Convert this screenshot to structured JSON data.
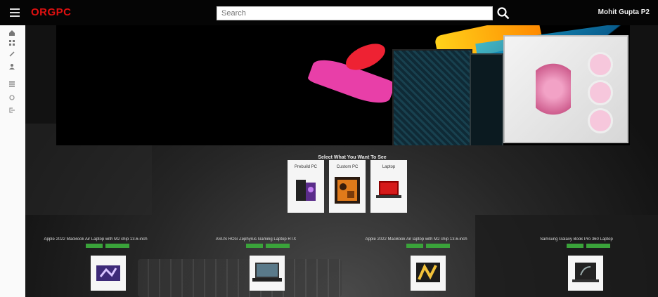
{
  "brand": "ORGPC",
  "search": {
    "placeholder": "Search"
  },
  "user": {
    "name": "Mohit Gupta P2"
  },
  "colors": {
    "brand": "#e01010",
    "accent_green": "#3aa33a",
    "topbar": "#050505"
  },
  "sidebar": {
    "icons": [
      "home-icon",
      "grid-icon",
      "tool-icon",
      "person-icon",
      "list-icon",
      "settings-icon",
      "logout-icon"
    ]
  },
  "select": {
    "title": "Select What You Want To See",
    "options": [
      {
        "label": "Prebuild PC",
        "icon": "prebuild-pc-image"
      },
      {
        "label": "Custom PC",
        "icon": "custom-pc-image"
      },
      {
        "label": "Laptop",
        "icon": "laptop-image"
      }
    ]
  },
  "products": [
    {
      "title": "Apple 2022 MacBook Air Laptop with M2 chip 13.6-inch",
      "image": "macbook-purple-image"
    },
    {
      "title": "ASUS ROG Zephyrus Gaming Laptop RTX",
      "image": "asus-laptop-image"
    },
    {
      "title": "Apple 2022 MacBook Air laptop with M2 chip 13.6-inch",
      "image": "macbook-gold-image"
    },
    {
      "title": "Samsung Galaxy Book Pro 360 Laptop",
      "image": "samsung-laptop-image"
    }
  ]
}
